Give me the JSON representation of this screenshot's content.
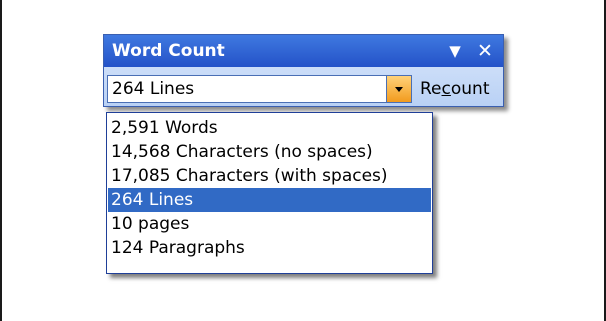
{
  "toolbar": {
    "title": "Word Count",
    "options_glyph": "▼",
    "close_glyph": "✕",
    "combo_value": "264 Lines",
    "recount_prefix": "Re",
    "recount_hotkey": "c",
    "recount_suffix": "ount"
  },
  "dropdown": {
    "items": [
      {
        "label": "2,591 Words",
        "selected": false
      },
      {
        "label": "14,568 Characters (no spaces)",
        "selected": false
      },
      {
        "label": "17,085 Characters (with spaces)",
        "selected": false
      },
      {
        "label": "264 Lines",
        "selected": true
      },
      {
        "label": "10 pages",
        "selected": false
      },
      {
        "label": "124 Paragraphs",
        "selected": false
      }
    ]
  },
  "colors": {
    "title_bar": "#2452c8",
    "selection": "#316ac5",
    "combo_arrow": "#f29b1e"
  },
  "icons": {
    "options": "chevron-down-icon",
    "close": "close-icon",
    "combo": "dropdown-arrow-icon"
  }
}
